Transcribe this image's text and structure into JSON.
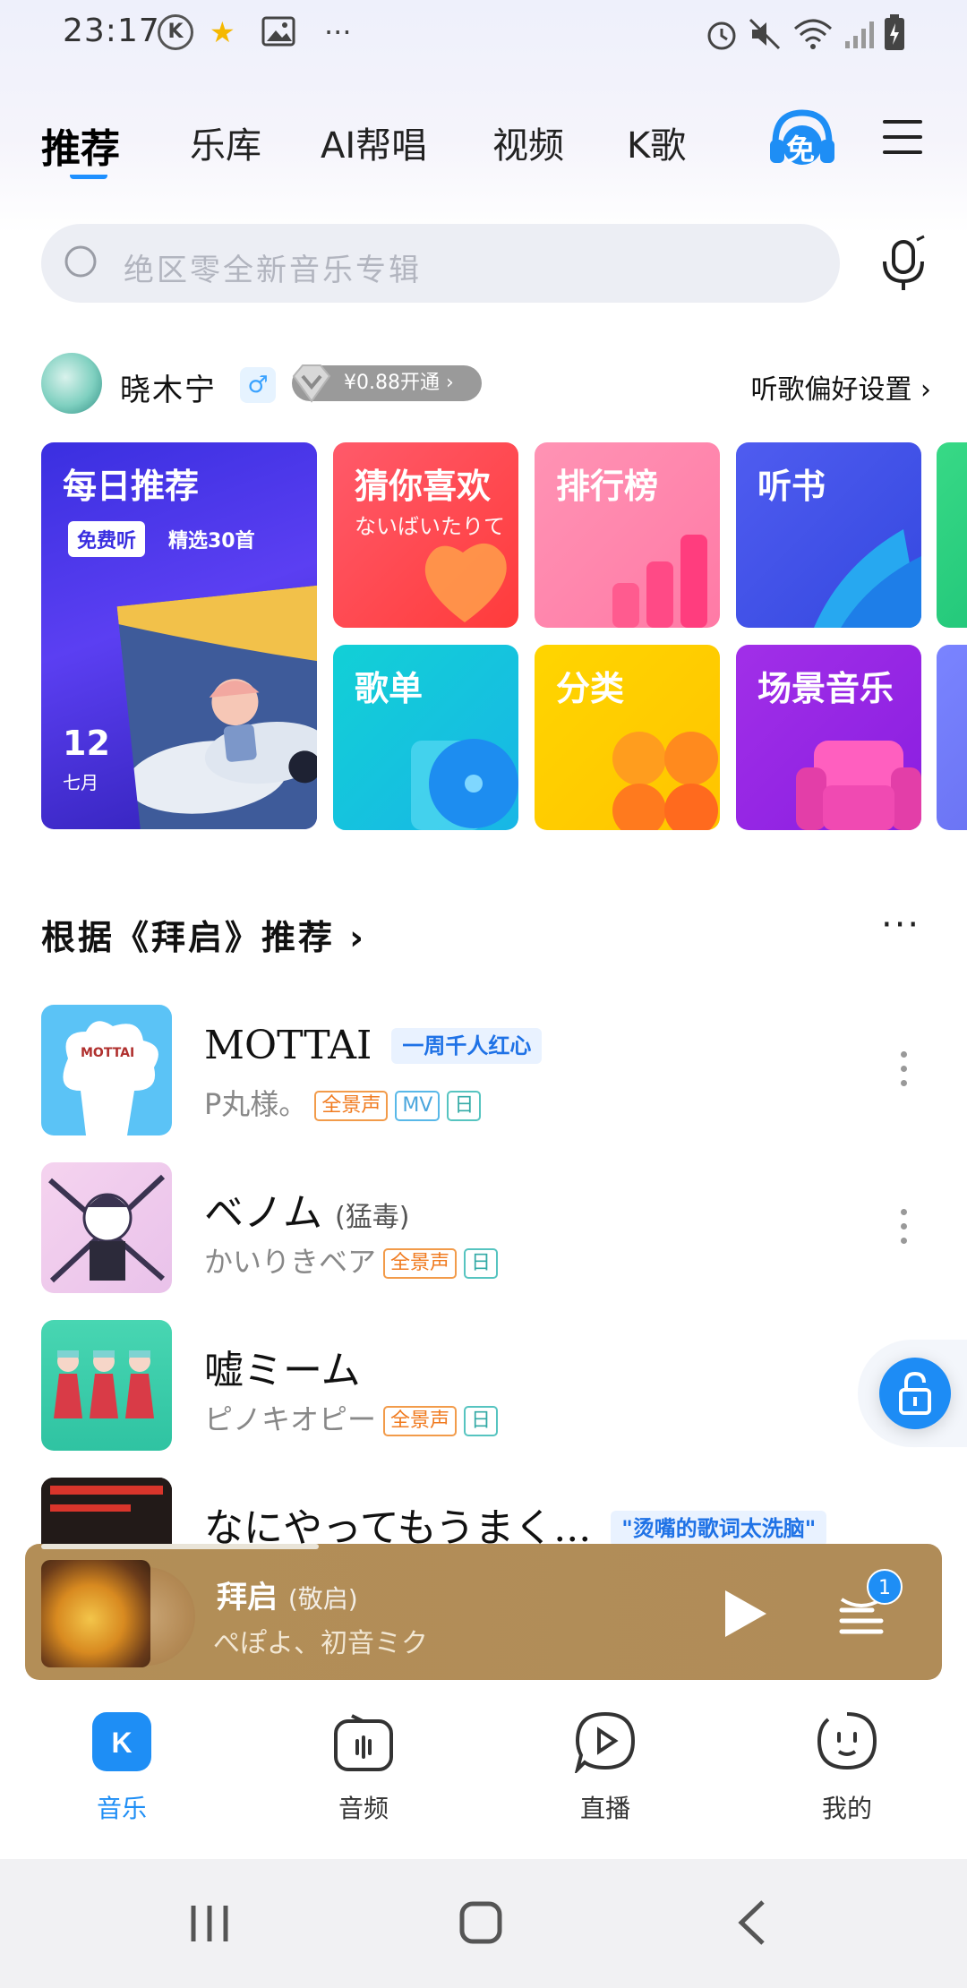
{
  "status_bar": {
    "time": "23:17",
    "left_icons": [
      "k-app-icon",
      "star-icon",
      "image-icon",
      "more-dots"
    ],
    "right_icons": [
      "alarm-icon",
      "mute-icon",
      "wifi-icon",
      "signal-icon",
      "battery-icon"
    ]
  },
  "top_nav": {
    "tabs": [
      {
        "label": "推荐",
        "active": true
      },
      {
        "label": "乐库",
        "active": false
      },
      {
        "label": "AI帮唱",
        "active": false
      },
      {
        "label": "视频",
        "active": false
      },
      {
        "label": "K歌",
        "active": false
      }
    ],
    "free_badge": "免"
  },
  "search": {
    "placeholder": "绝区零全新音乐专辑"
  },
  "user": {
    "name": "晓木宁",
    "gender_icon": "♂",
    "vip_text": "¥0.88开通 ›",
    "preference_link": "听歌偏好设置 ›"
  },
  "cards": {
    "daily": {
      "title": "每日推荐",
      "free_chip": "免费听",
      "picks": "精选30首",
      "day": "12",
      "month": "七月"
    },
    "guess": {
      "title": "猜你喜欢",
      "subtitle": "ないばいたりて"
    },
    "rank": {
      "title": "排行榜"
    },
    "book": {
      "title": "听书"
    },
    "playlist": {
      "title": "歌单"
    },
    "category": {
      "title": "分类"
    },
    "scene": {
      "title": "场景音乐"
    }
  },
  "section": {
    "title": "根据《拜启》推荐 ›",
    "more": "···"
  },
  "songs": [
    {
      "title": "MOTTAI",
      "paren": "",
      "hot_tag": "一周千人红心",
      "artist": "P丸様。",
      "tags": [
        "全景声",
        "MV",
        "日"
      ],
      "cover_text": "MOTTAI"
    },
    {
      "title": "ベノム",
      "paren": "(猛毒)",
      "hot_tag": "",
      "artist": "かいりきベア",
      "tags": [
        "全景声",
        "日"
      ]
    },
    {
      "title": "嘘ミーム",
      "paren": "",
      "hot_tag": "",
      "artist": "ピノキオピー",
      "tags": [
        "全景声",
        "日"
      ]
    },
    {
      "title": "なにやってもうまく...",
      "paren": "",
      "hot_tag": "\"烫嘴的歌词太洗脑\"",
      "artist": "",
      "tags": []
    }
  ],
  "player": {
    "title": "拜启",
    "paren": "(敬启)",
    "artist": "ぺぽよ、初音ミク",
    "queue_count": "1"
  },
  "tabbar": [
    {
      "label": "音乐",
      "active": true,
      "icon": "k-music-icon"
    },
    {
      "label": "音频",
      "active": false,
      "icon": "radio-icon"
    },
    {
      "label": "直播",
      "active": false,
      "icon": "live-icon"
    },
    {
      "label": "我的",
      "active": false,
      "icon": "profile-icon"
    }
  ],
  "colors": {
    "accent": "#1e8ef5",
    "player_bg": "#b38e57"
  }
}
